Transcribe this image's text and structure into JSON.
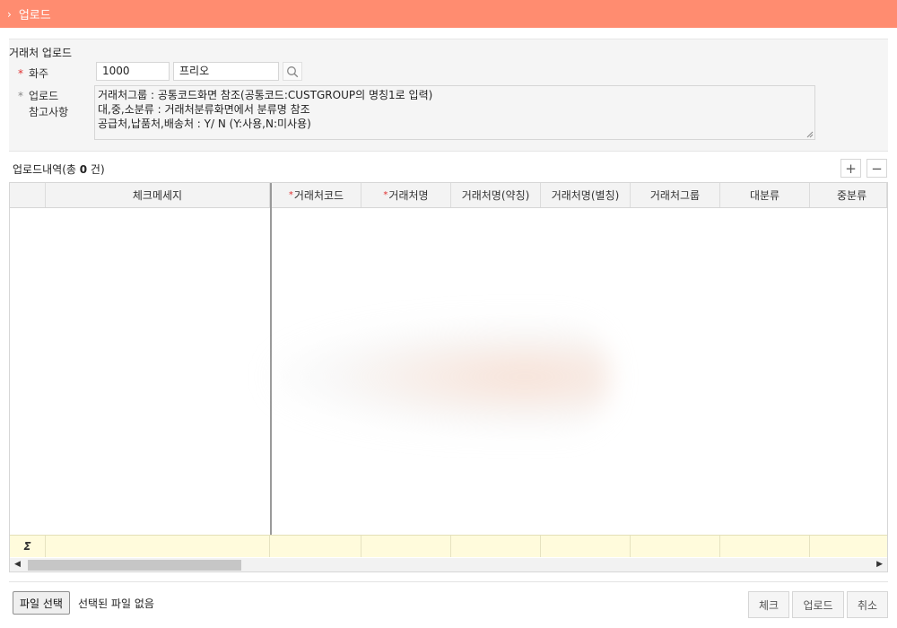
{
  "header": {
    "title": "업로드"
  },
  "form": {
    "section_title": "거래처 업로드",
    "owner_label": "화주",
    "owner_code": "1000",
    "owner_name": "프리오",
    "notes_label_1": "업로드",
    "notes_label_2": "참고사항",
    "notes": [
      "거래처그룹 : 공통코드화면 참조(공통코드:CUSTGROUP의 명칭1로 입력)",
      "대,중,소분류 : 거래처분류화면에서 분류명 참조",
      "공급처,납품처,배송처 : Y/ N (Y:사용,N:미사용)"
    ]
  },
  "grid": {
    "title_prefix": "업로드내역(총 ",
    "count": "0",
    "title_suffix": " 건)",
    "add_label": "+",
    "remove_label": "−",
    "sum_symbol": "Σ",
    "columns": [
      {
        "label": "체크메세지",
        "required": false
      },
      {
        "label": "거래처코드",
        "required": true
      },
      {
        "label": "거래처명",
        "required": true
      },
      {
        "label": "거래처명(약칭)",
        "required": false
      },
      {
        "label": "거래처명(별칭)",
        "required": false
      },
      {
        "label": "거래처그룹",
        "required": false
      },
      {
        "label": "대분류",
        "required": false
      },
      {
        "label": "중분류",
        "required": false
      }
    ],
    "required_mark": "*"
  },
  "footer": {
    "file_button": "파일 선택",
    "file_status": "선택된 파일 없음",
    "check_button": "체크",
    "upload_button": "업로드",
    "cancel_button": "취소"
  },
  "colors": {
    "header_bg": "#ff8c70",
    "required": "#e03030",
    "sum_row_bg": "#fffbdc"
  }
}
